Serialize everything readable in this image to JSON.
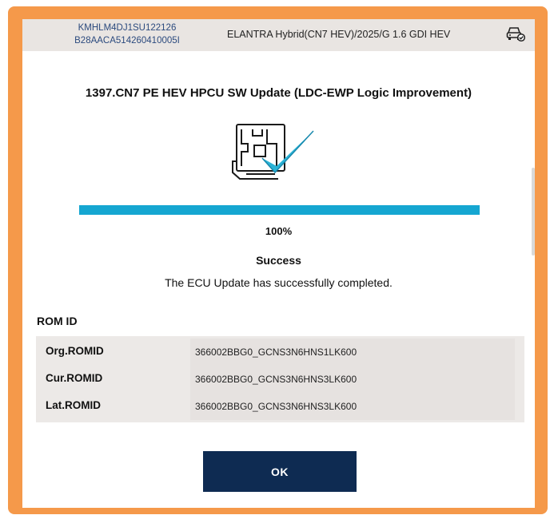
{
  "header": {
    "vin": "KMHLM4DJ1SU122126",
    "id_code": "B28AACA514260410005I",
    "vehicle": "ELANTRA Hybrid(CN7 HEV)/2025/G 1.6 GDI HEV",
    "vehicle_icon": "car-diagnostic-icon"
  },
  "update": {
    "title": "1397.CN7 PE HEV HPCU SW Update (LDC-EWP Logic Improvement)",
    "icon": "ecu-update-complete-icon",
    "progress": 100,
    "percent_label": "100%",
    "status": "Success",
    "message": "The ECU Update has successfully completed."
  },
  "rom": {
    "heading": "ROM ID",
    "rows": [
      {
        "label": "Org.ROMID",
        "value": "366002BBG0_GCNS3N6HNS1LK600"
      },
      {
        "label": "Cur.ROMID",
        "value": "366002BBG0_GCNS3N6HNS3LK600"
      },
      {
        "label": "Lat.ROMID",
        "value": "366002BBG0_GCNS3N6HNS3LK600"
      }
    ]
  },
  "actions": {
    "ok_label": "OK"
  },
  "colors": {
    "frame": "#f5994a",
    "progress": "#15a6d1",
    "button": "#0e2b52",
    "vin_text": "#2b4a7e"
  }
}
